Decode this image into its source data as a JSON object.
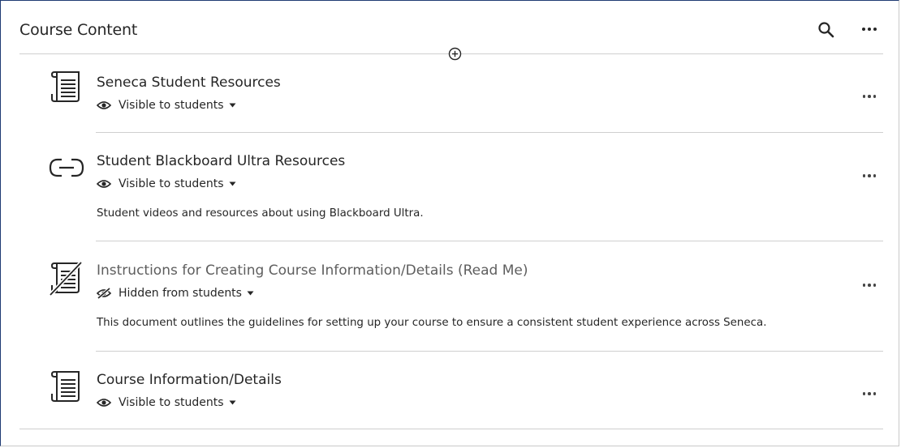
{
  "header": {
    "title": "Course Content"
  },
  "items": [
    {
      "title": "Seneca Student Resources",
      "visibility": "Visible to students",
      "description": ""
    },
    {
      "title": "Student Blackboard Ultra Resources",
      "visibility": "Visible to students",
      "description": "Student videos and resources about using Blackboard Ultra."
    },
    {
      "title": "Instructions for Creating Course Information/Details (Read Me)",
      "visibility": "Hidden from students",
      "description": "This document outlines the guidelines for setting up your course to ensure a consistent student experience across Seneca."
    },
    {
      "title": "Course Information/Details",
      "visibility": "Visible to students",
      "description": ""
    }
  ],
  "icons": {
    "search": "search-icon",
    "more": "more-options-icon",
    "add": "add-content-icon",
    "document": "document-icon",
    "link": "link-icon",
    "hidden_document": "hidden-document-icon",
    "visible": "eye-icon",
    "hidden": "eye-slash-icon",
    "caret": "caret-down-icon"
  },
  "colors": {
    "frame_accent": "#1f3b73",
    "text": "#262626",
    "muted_text": "#5e5e5e",
    "divider": "#cfcfcf"
  }
}
